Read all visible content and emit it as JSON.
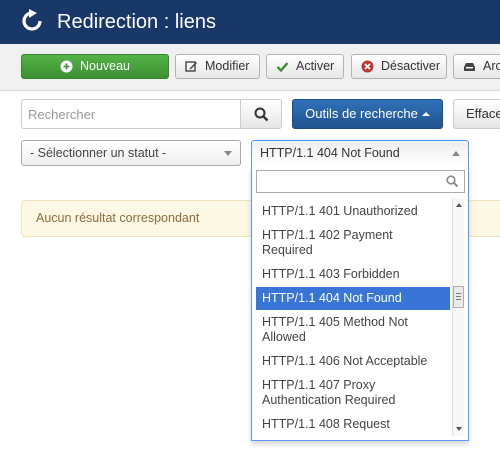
{
  "header": {
    "title": "Redirection : liens",
    "icon": "refresh-icon",
    "background": "#1a3867"
  },
  "toolbar": {
    "new_label": "Nouveau",
    "edit_label": "Modifier",
    "activate_label": "Activer",
    "deactivate_label": "Désactiver",
    "archive_label": "Arc"
  },
  "search": {
    "placeholder": "Rechercher",
    "tools_label": "Outils de recherche",
    "clear_label": "Efface"
  },
  "filters": {
    "status_selected": "- Sélectionner un statut -",
    "code_selected": "HTTP/1.1 404 Not Found"
  },
  "alert": {
    "message": "Aucun résultat correspondant"
  },
  "dropdown": {
    "search_value": "",
    "items": [
      "HTTP/1.1 401 Unauthorized",
      "HTTP/1.1 402 Payment Required",
      "HTTP/1.1 403 Forbidden",
      "HTTP/1.1 404 Not Found",
      "HTTP/1.1 405 Method Not Allowed",
      "HTTP/1.1 406 Not Acceptable",
      "HTTP/1.1 407 Proxy Authentication Required",
      "HTTP/1.1 408 Request"
    ],
    "highlighted_index": 3
  },
  "colors": {
    "new_button": "#46a33b",
    "tools_button": "#2a64a6",
    "highlight": "#3875d7",
    "alert_bg": "#fcf8e3",
    "alert_text": "#8a6d3b"
  }
}
